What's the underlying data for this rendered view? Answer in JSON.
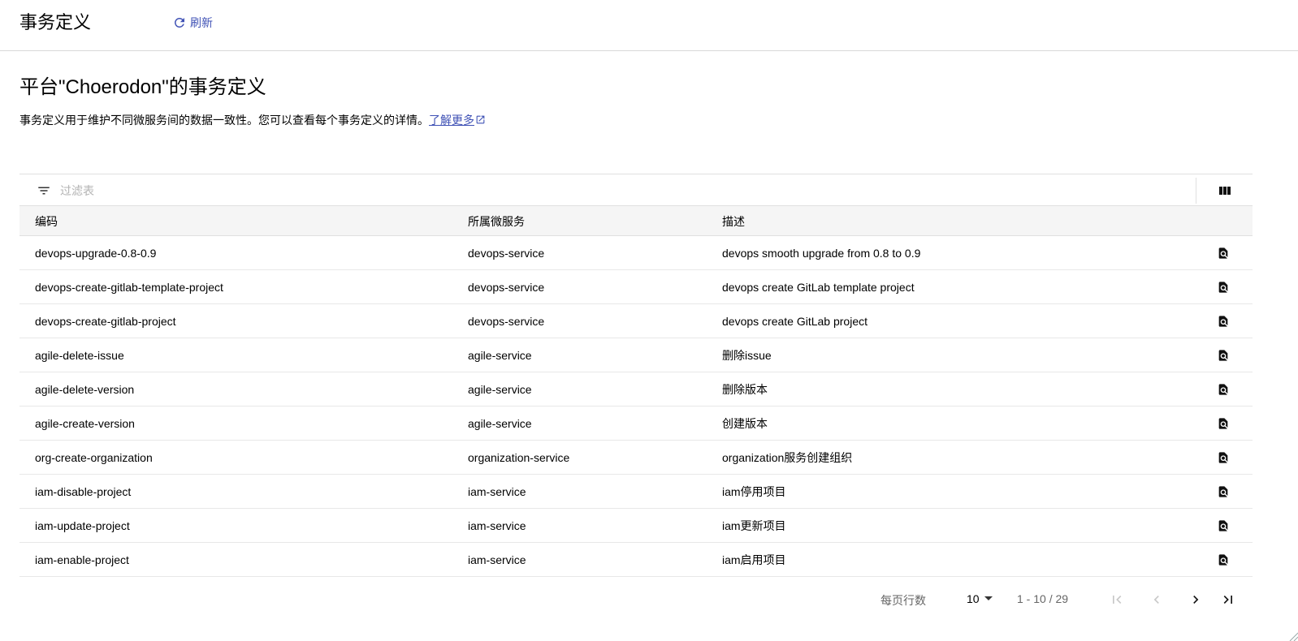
{
  "header": {
    "title": "事务定义",
    "refresh_label": "刷新"
  },
  "main": {
    "heading": "平台\"Choerodon\"的事务定义",
    "description": "事务定义用于维护不同微服务间的数据一致性。您可以查看每个事务定义的详情。",
    "learn_more": "了解更多"
  },
  "filter": {
    "placeholder": "过滤表"
  },
  "table": {
    "columns": [
      "编码",
      "所属微服务",
      "描述"
    ],
    "rows": [
      {
        "code": "devops-upgrade-0.8-0.9",
        "service": "devops-service",
        "desc": "devops smooth upgrade from 0.8 to 0.9"
      },
      {
        "code": "devops-create-gitlab-template-project",
        "service": "devops-service",
        "desc": "devops create GitLab template project"
      },
      {
        "code": "devops-create-gitlab-project",
        "service": "devops-service",
        "desc": "devops create GitLab project"
      },
      {
        "code": "agile-delete-issue",
        "service": "agile-service",
        "desc": "删除issue"
      },
      {
        "code": "agile-delete-version",
        "service": "agile-service",
        "desc": "删除版本"
      },
      {
        "code": "agile-create-version",
        "service": "agile-service",
        "desc": "创建版本"
      },
      {
        "code": "org-create-organization",
        "service": "organization-service",
        "desc": "organization服务创建组织"
      },
      {
        "code": "iam-disable-project",
        "service": "iam-service",
        "desc": "iam停用项目"
      },
      {
        "code": "iam-update-project",
        "service": "iam-service",
        "desc": "iam更新项目"
      },
      {
        "code": "iam-enable-project",
        "service": "iam-service",
        "desc": "iam启用项目"
      }
    ]
  },
  "pagination": {
    "rows_per_page_label": "每页行数",
    "rows_per_page_value": "10",
    "range": "1 - 10 / 29"
  },
  "icons": {
    "refresh": "refresh-icon",
    "external_link": "external-link-icon",
    "filter": "filter-icon",
    "columns": "columns-icon",
    "detail": "find-in-page-icon",
    "first_page": "first-page-icon",
    "prev_page": "chevron-left-icon",
    "next_page": "chevron-right-icon",
    "last_page": "last-page-icon"
  },
  "colors": {
    "accent": "#3f51b5",
    "header_bg": "#f5f5f5",
    "border": "#e0e0e0"
  }
}
